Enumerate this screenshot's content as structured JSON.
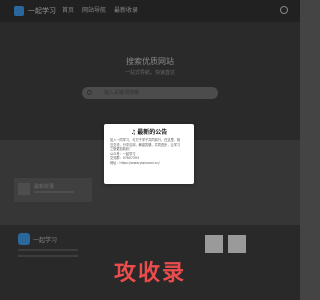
{
  "header": {
    "brand": "一起学习",
    "nav": [
      "首页",
      "网站导航",
      "最新收录"
    ]
  },
  "hero": {
    "title": "搜索优质网站",
    "subtitle": "一站式导航，快速直达",
    "search_placeholder": "输入关键词搜索"
  },
  "main": {
    "card_title": "最新收录"
  },
  "footer": {
    "brand": "一起学习"
  },
  "modal": {
    "title": "最新的公告",
    "bell_icon": "bell-icon",
    "lines": [
      "加入一同学习，与万千学子共同前行，在这里，相",
      "互交流，分享见闻，解惑答疑，共同进步，让学习",
      "之旅更加精彩！",
      "公众号：一起学习",
      "交流群：97807393",
      "网址：https://www.yiqixuexi.cn/"
    ]
  },
  "watermark": "攻收录",
  "colors": {
    "accent": "#ec4c4c",
    "brand": "#3a8fd9"
  }
}
